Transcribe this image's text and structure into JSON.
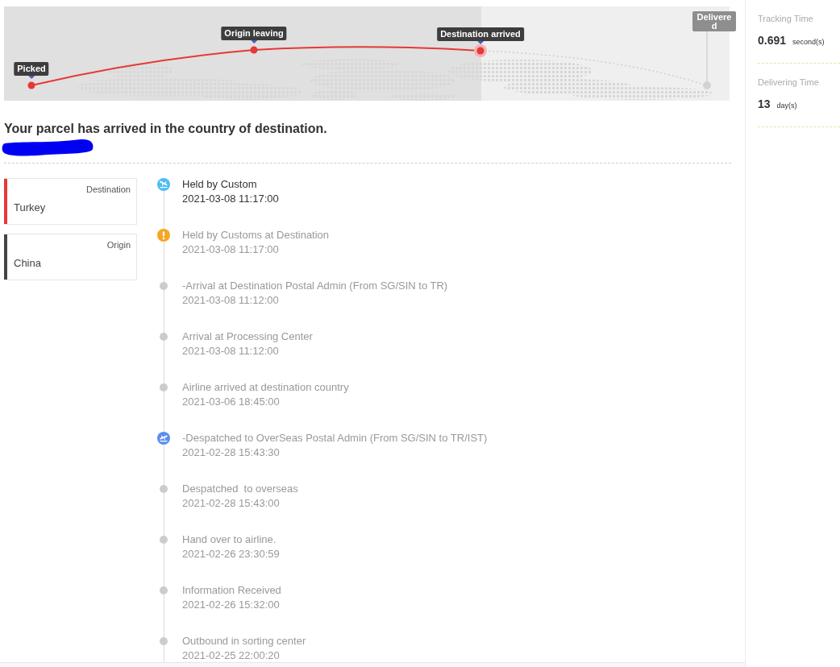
{
  "route": {
    "stops": [
      {
        "label": "Picked",
        "reached": true,
        "current": false
      },
      {
        "label": "Origin leaving",
        "reached": true,
        "current": false
      },
      {
        "label": "Destination arrived",
        "reached": true,
        "current": true
      },
      {
        "label": "Delivered",
        "reached": false,
        "current": false
      }
    ]
  },
  "status": {
    "headline": "Your parcel has arrived in the country of destination.",
    "tracking_number_redacted": true
  },
  "places": [
    {
      "role": "Destination",
      "country": "Turkey",
      "color": "#e53935"
    },
    {
      "role": "Origin",
      "country": "China",
      "color": "#444444"
    }
  ],
  "events": [
    {
      "kind": "arrival",
      "title": "Held by Custom",
      "time": "2021-03-08 11:17:00",
      "latest": true
    },
    {
      "kind": "alert",
      "title": "Held by Customs at Destination",
      "time": "2021-03-08 11:17:00",
      "latest": false
    },
    {
      "kind": "dot",
      "title": "-Arrival at Destination Postal Admin (From SG/SIN to TR)",
      "time": "2021-03-08 11:12:00",
      "latest": false
    },
    {
      "kind": "dot",
      "title": "Arrival at Processing Center",
      "time": "2021-03-08 11:12:00",
      "latest": false
    },
    {
      "kind": "dot",
      "title": "Airline arrived at destination country",
      "time": "2021-03-06 18:45:00",
      "latest": false
    },
    {
      "kind": "departure",
      "title": "-Despatched to OverSeas Postal Admin (From SG/SIN to TR/IST)",
      "time": "2021-02-28 15:43:30",
      "latest": false
    },
    {
      "kind": "dot",
      "title": "Despatched  to overseas",
      "time": "2021-02-28 15:43:00",
      "latest": false
    },
    {
      "kind": "dot",
      "title": "Hand over to airline.",
      "time": "2021-02-26 23:30:59",
      "latest": false
    },
    {
      "kind": "dot",
      "title": "Information Received",
      "time": "2021-02-26 15:32:00",
      "latest": false
    },
    {
      "kind": "dot",
      "title": "Outbound in sorting center",
      "time": "2021-02-25 22:00:20",
      "latest": false
    }
  ],
  "stats": [
    {
      "label": "Tracking Time",
      "value": "0.691",
      "unit": "second(s)"
    },
    {
      "label": "Delivering Time",
      "value": "13",
      "unit": "day(s)"
    }
  ]
}
